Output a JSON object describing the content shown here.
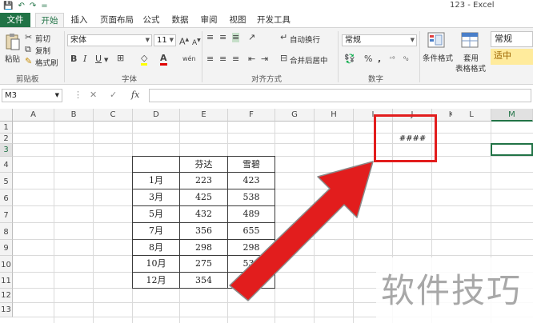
{
  "window": {
    "title": "123 - Excel"
  },
  "quick_access": {
    "save": "💾",
    "undo": "↶",
    "redo": "↷",
    "customize": "="
  },
  "tabs": [
    "文件",
    "开始",
    "插入",
    "页面布局",
    "公式",
    "数据",
    "审阅",
    "视图",
    "开发工具"
  ],
  "ribbon": {
    "clipboard": {
      "paste": "粘贴",
      "cut": "剪切",
      "copy": "复制",
      "format_painter": "格式刷",
      "label": "剪贴板"
    },
    "font": {
      "name": "宋体",
      "size": "11",
      "grow": "A",
      "shrink": "A",
      "bold": "B",
      "italic": "I",
      "underline": "U",
      "wen": "wén",
      "label": "字体"
    },
    "alignment": {
      "wrap": "自动换行",
      "merge": "合并后居中",
      "label": "对齐方式"
    },
    "number": {
      "format": "常规",
      "percent": "%",
      "comma": ",",
      "label": "数字"
    },
    "styles": {
      "conditional": "条件格式",
      "table_format_1": "套用",
      "table_format_2": "表格格式",
      "normal": "常规",
      "neutral": "适中"
    }
  },
  "formula_bar": {
    "name_box": "M3",
    "fx": "fx",
    "cancel": "✕",
    "enter": "✓"
  },
  "columns": [
    "A",
    "B",
    "C",
    "D",
    "E",
    "F",
    "G",
    "H",
    "I",
    "J",
    "K",
    "L",
    "M"
  ],
  "rows": [
    "1",
    "2",
    "3",
    "4",
    "5",
    "6",
    "7",
    "8",
    "9",
    "10",
    "11",
    "12",
    "13"
  ],
  "selected": {
    "column": "M",
    "row": "3"
  },
  "cell_j2": "####",
  "table": {
    "headers": [
      "",
      "芬达",
      "雪碧"
    ],
    "rows": [
      [
        "1月",
        "223",
        "423"
      ],
      [
        "3月",
        "425",
        "538"
      ],
      [
        "5月",
        "432",
        "489"
      ],
      [
        "7月",
        "356",
        "655"
      ],
      [
        "8月",
        "298",
        "298"
      ],
      [
        "10月",
        "275",
        "539"
      ],
      [
        "12月",
        "354",
        ""
      ]
    ]
  },
  "annotation_colors": {
    "highlight": "#e21d1d",
    "excel_green": "#217346"
  },
  "watermark": "软件技巧"
}
